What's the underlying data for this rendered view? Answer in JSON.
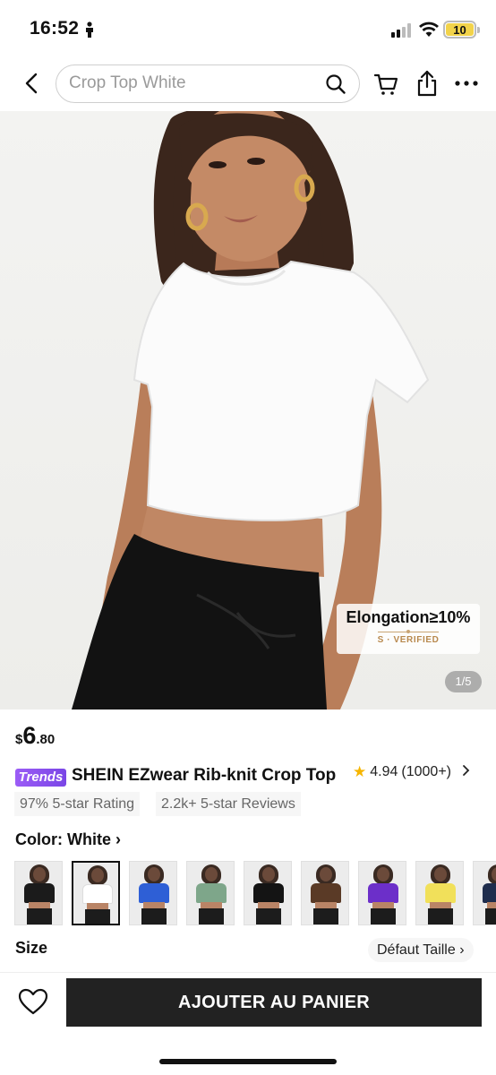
{
  "status_bar": {
    "time": "16:52",
    "battery": "10"
  },
  "nav": {
    "search_placeholder": "Crop Top White"
  },
  "gallery": {
    "badge_title": "Elongation≥10%",
    "badge_sub": "S · VERIFIED",
    "counter": "1/5"
  },
  "product": {
    "price_currency": "$",
    "price_int": "6",
    "price_dec": ".80",
    "trends_label": "Trends",
    "title": "SHEIN EZwear Rib-knit Crop Top",
    "rating_value": "4.94",
    "rating_count": "(1000+)",
    "chip_1": "97% 5-star Rating",
    "chip_2": "2.2k+ 5-star Reviews",
    "color_label": "Color: White",
    "color_chevron": "›",
    "size_label": "Size",
    "size_button": "Défaut Taille",
    "size_chevron": "›",
    "swatch_colors": [
      "#1b1b1b",
      "#ffffff",
      "#2e5fd6",
      "#7ea68a",
      "#141414",
      "#5a3a26",
      "#6c2fc9",
      "#f1e05a",
      "#1f2d4d"
    ],
    "selected_swatch": 1
  },
  "actions": {
    "add_to_cart": "AJOUTER AU PANIER"
  },
  "colors": {
    "trends_purple": "#8650f0",
    "button_dark": "#222222",
    "star_yellow": "#f6b500"
  }
}
